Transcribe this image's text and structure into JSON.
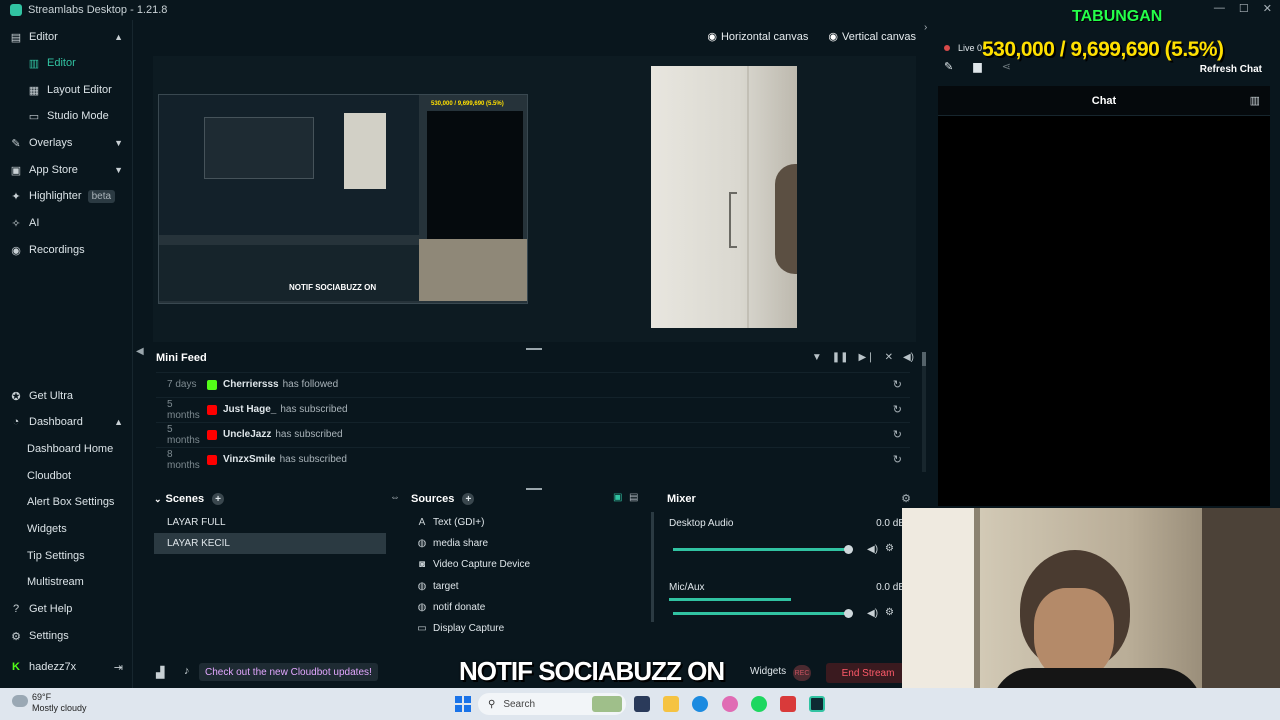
{
  "window": {
    "title": "Streamlabs Desktop - 1.21.8"
  },
  "sidebar": {
    "items": [
      {
        "label": "Editor",
        "icon": "editor-icon"
      },
      {
        "label": "Editor",
        "icon": "editor-subitem-icon"
      },
      {
        "label": "Layout Editor",
        "icon": "layout-icon"
      },
      {
        "label": "Studio Mode",
        "icon": "studio-icon"
      },
      {
        "label": "Overlays",
        "icon": "overlays-icon"
      },
      {
        "label": "App Store",
        "icon": "store-icon"
      },
      {
        "label": "Highlighter",
        "icon": "highlighter-icon",
        "badge": "beta"
      },
      {
        "label": "AI",
        "icon": "ai-icon"
      },
      {
        "label": "Recordings",
        "icon": "recordings-icon"
      }
    ],
    "bottom": [
      {
        "label": "Get Ultra",
        "icon": "ultra-icon"
      },
      {
        "label": "Dashboard",
        "icon": "dashboard-icon"
      },
      {
        "label": "Dashboard Home"
      },
      {
        "label": "Cloudbot"
      },
      {
        "label": "Alert Box Settings"
      },
      {
        "label": "Widgets"
      },
      {
        "label": "Tip Settings"
      },
      {
        "label": "Multistream"
      },
      {
        "label": "Get Help",
        "icon": "help-icon"
      },
      {
        "label": "Settings",
        "icon": "settings-icon"
      },
      {
        "label": "hadezz7x",
        "icon": "kick-icon"
      }
    ]
  },
  "canvas": {
    "horizontal": "Horizontal canvas",
    "vertical": "Vertical canvas"
  },
  "preview": {
    "caption": "NOTIF SOCIABUZZ ON",
    "ticker": "530,000 / 9,699,690 (5.5%)",
    "ticker_title": "TABUNGAN"
  },
  "minifeed": {
    "title": "Mini Feed",
    "rows": [
      {
        "age": "7 days",
        "name": "Cherriersss",
        "action": "has followed",
        "platform_color": "#53fc18"
      },
      {
        "age": "5 months",
        "name": "Just Hage_",
        "action": "has subscribed",
        "platform_color": "#ff0000"
      },
      {
        "age": "5 months",
        "name": "UncleJazz",
        "action": "has subscribed",
        "platform_color": "#ff0000"
      },
      {
        "age": "8 months",
        "name": "VinzxSmile",
        "action": "has subscribed",
        "platform_color": "#ff0000"
      }
    ]
  },
  "scenes": {
    "title": "Scenes",
    "items": [
      "LAYAR FULL",
      "LAYAR KECIL"
    ],
    "selected": 1
  },
  "sources": {
    "title": "Sources",
    "items": [
      {
        "label": "Text (GDI+)",
        "icon": "text-icon"
      },
      {
        "label": "media share",
        "icon": "globe-icon"
      },
      {
        "label": "Video Capture Device",
        "icon": "camera-icon"
      },
      {
        "label": "target",
        "icon": "globe-icon"
      },
      {
        "label": "notif donate",
        "icon": "globe-icon"
      },
      {
        "label": "Display Capture",
        "icon": "monitor-icon"
      }
    ]
  },
  "mixer": {
    "title": "Mixer",
    "channels": [
      {
        "label": "Desktop Audio",
        "db": "0.0 dB",
        "volume": 1.0,
        "level": 0.0
      },
      {
        "label": "Mic/Aux",
        "db": "0.0 dB",
        "volume": 1.0,
        "level": 0.72
      }
    ]
  },
  "footer": {
    "cloudbot_note": "Check out the new Cloudbot updates!",
    "widgets": "Widgets",
    "rec": "REC",
    "end_stream": "End Stream"
  },
  "chat": {
    "live": "Live 0",
    "title": "Chat",
    "refresh": "Refresh Chat"
  },
  "overlay": {
    "tabungan": "TABUNGAN",
    "progress": "530,000 / 9,699,690 (5.5%)",
    "notif": "NOTIF SOCIABUZZ ON"
  },
  "taskbar": {
    "temp": "69°F",
    "condition": "Mostly cloudy",
    "search": "Search"
  },
  "colors": {
    "accent": "#31c3a2",
    "end_stream": "#ff5a6a",
    "tabungan": "#24ff4a",
    "progress": "#ffe000"
  }
}
